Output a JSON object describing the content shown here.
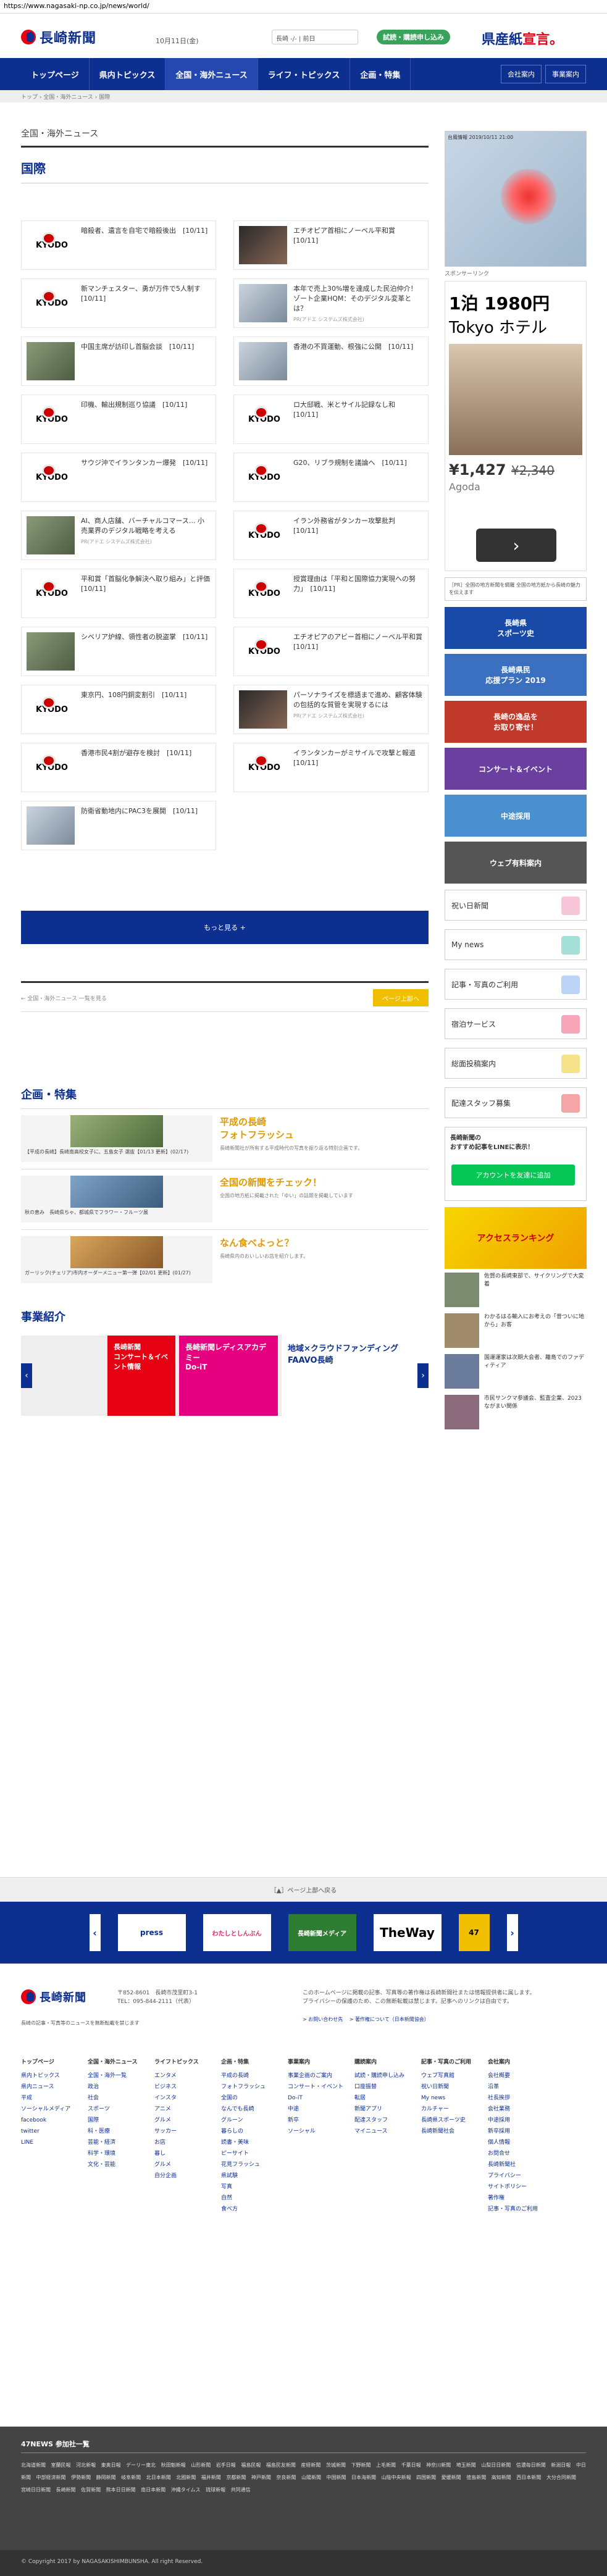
{
  "browser": {
    "url": "https://www.nagasaki-np.co.jp/news/world/"
  },
  "header": {
    "logo": "長崎新聞",
    "date": "10月11日(金)",
    "weather": "長崎  -/-  |  前日",
    "trial": "試読・購読申し込み",
    "slogan_a": "県産紙",
    "slogan_b": "宣言。"
  },
  "nav": {
    "items": [
      "トップページ",
      "県内トピックス",
      "全国・海外ニュース",
      "ライフ・トピックス",
      "企画・特集"
    ],
    "company": "会社案内",
    "business": "事業案内"
  },
  "breadcrumb": "トップ › 全国・海外ニュース › 国際",
  "section": {
    "title": "全国・海外ニュース",
    "subtitle": "国際"
  },
  "articles": [
    {
      "text": "暗殺者、遺言を自宅で暗殺後出　[10/11]",
      "img": "kyodo"
    },
    {
      "text": "エチオピア首相にノーベル平和賞　[10/11]",
      "img": "photo3"
    },
    {
      "text": "新マンチェスター、勇が万件で5人制す　[10/11]",
      "img": "kyodo"
    },
    {
      "text": "本年で売上30%増を達成した民泊仲介！ゾート企業HQM：そのデジタル変革とは？",
      "img": "photo2",
      "pr": "PR(アドエ システムズ株式会社)"
    },
    {
      "text": "中国主席が訪印し首脳会談　[10/11]",
      "img": "photo"
    },
    {
      "text": "香港の不買運動、根強に公開　[10/11]",
      "img": "photo2"
    },
    {
      "text": "印機、輸出規制巡り協議　[10/11]",
      "img": "kyodo"
    },
    {
      "text": "ロ大邸戦、米とサイル記録なし和　[10/11]",
      "img": "kyodo"
    },
    {
      "text": "サウジ沖でイランタンカー爆発　[10/11]",
      "img": "kyodo"
    },
    {
      "text": "G20、リブラ規制を議論へ　[10/11]",
      "img": "kyodo"
    },
    {
      "text": "AI、商人店舗、バーチャルコマース... 小売業界のデジタル戦略を考える",
      "img": "photo",
      "pr": "PR(アドエ システムズ株式会社)"
    },
    {
      "text": "イラン外務省がタンカー攻撃批判　[10/11]",
      "img": "kyodo"
    },
    {
      "text": "平和賞「首脳化争解決へ取り組み」と評価　[10/11]",
      "img": "kyodo"
    },
    {
      "text": "授賞理由は「平和と国際協力実現への努力」　[10/11]",
      "img": "kyodo"
    },
    {
      "text": "シベリア炉線、領性者の脱盗掌　[10/11]",
      "img": "photo"
    },
    {
      "text": "エチオピアのアビー首相にノーベル平和賞　[10/11]",
      "img": "kyodo"
    },
    {
      "text": "東京円、108円銅変割引　[10/11]",
      "img": "kyodo"
    },
    {
      "text": "パーソナライズを標語まで進め、顧客体験の包括的な質管を実現するには",
      "img": "photo3",
      "pr": "PR(アドエ システムズ株式会社)"
    },
    {
      "text": "香港市民4割が避存を検討　[10/11]",
      "img": "kyodo"
    },
    {
      "text": "イランタンカーがミサイルで攻撃と報道　[10/11]",
      "img": "kyodo"
    },
    {
      "text": "防衛省動地内にPAC3を展開　[10/11]",
      "img": "photo2"
    }
  ],
  "more_label": "もっと見る +",
  "pager": {
    "prev": "← 全国・海外ニュース 一覧を見る",
    "next": "ページ上部へ"
  },
  "kikaku": {
    "title": "企画・特集",
    "items": [
      {
        "caption": "【平成の長崎】長崎南高校女子に、五島女子 選抜【01/13 更新】(02/17)",
        "head": "平成の長崎\nフォトフラッシュ",
        "desc": "長崎新聞社が所有する平成時代の写真を振り返る特別企画です。"
      },
      {
        "caption": "秋の恵み　長崎県ちゃ、都城県でフラワー・フルーツ展",
        "head": "全国の新聞をチェック！",
        "desc": "全国の地方紙に掲載された「ゆい」の話題を掲載しています"
      },
      {
        "caption": "ガーリック(チェリア)市内オーダーメニュー第一弾【02/01 更新】(01/27)",
        "head": "なん食べよっと？",
        "desc": "長崎県内のおいしいお店を紹介します。"
      }
    ]
  },
  "jigyo": {
    "title": "事業紹介",
    "banners": [
      "長崎新聞\nコンサート＆イベント情報",
      "長崎新聞レディスアカデミー\nDo-iT",
      "地域×クラウドファンディング\nFAAVO長崎"
    ]
  },
  "sidebar": {
    "typhoon_label": "台風情報  2019/10/11 21:00",
    "sponsor": "スポンサーリンク",
    "ad_h1": "1泊 1980円",
    "ad_h2": "Tokyo ホテル",
    "ad_price": "¥1,427",
    "ad_old": "¥2,340",
    "ad_src": "Agoda",
    "notice": "［PR］全国の地方新聞を網羅 全国の地方紙から長崎の魅力を伝えます",
    "banners": [
      "長崎県\nスポーツ史",
      "長崎県民\n応援プラン 2019",
      "長崎の逸品を\nお取り寄せ！",
      "コンサート＆イベント",
      "中途採用",
      "ウェブ有料案内"
    ],
    "services": [
      "祝い日新聞",
      "My news",
      "記事・写真のご利用",
      "宿泊サービス",
      "総面投稿案内",
      "配達スタッフ募集"
    ],
    "line_title": "長崎新聞の\nおすすめ記事をLINEに表示！",
    "line_btn": "アカウントを友達に追加",
    "rank_label": "アクセスランキング",
    "rank_items": [
      "佐賀の長崎東部で、サイクリングで大変着",
      "わかるはる輸入にお考えの「昔ついに地から」お客",
      "国運運家は次期大会者、離島でのファディティア",
      "市民サンクマ参議会、監査企業、2023 ながまい関係"
    ]
  },
  "bottom_bar": "［▲］ページ上部へ戻る",
  "partners": [
    "press",
    "わたしとしんぶん",
    "長崎新聞メディア",
    "TheWay",
    "47"
  ],
  "footer": {
    "logo": "長崎新聞",
    "address": "〒852-8601　長崎市茂里町3-1\nTEL：095-844-2111（代表）",
    "note": "長崎の記事・写真等のニュースを無断転載を禁じます",
    "right_text": "このホームページに掲載の記事、写真等の著作権は長崎新聞社または情報提供者に属します。\nプライバシーの保護のため、この無断転載は禁じます。記事へのリンクは自由です。",
    "links": "> お問い合わせ先　 > 著作権について（日本新聞協会）",
    "cols": [
      {
        "h": "トップページ",
        "items": [
          "県内トピックス",
          "県内ニュース",
          "平成",
          "ソーシャルメディア",
          "facebook",
          "twitter",
          "LINE"
        ]
      },
      {
        "h": "全国・海外ニュース",
        "items": [
          "全国・海外一覧",
          "政治",
          "社会",
          "スポーツ",
          "国際",
          "科・医療",
          "芸能・経済",
          "科学・環境",
          "文化・芸能"
        ]
      },
      {
        "h": "ライフトピックス",
        "items": [
          "エンタメ",
          "ビジネス",
          "インスタ",
          "アニメ",
          "グルメ",
          "サッカー",
          "お店",
          "暮し",
          "グルメ",
          "自分企画"
        ]
      },
      {
        "h": "企画・特集",
        "items": [
          "平成の長崎",
          "フォトフラッシュ",
          "全国の",
          "なんでも長崎",
          "グルーン",
          "暮らしの",
          "読書・美味",
          "ピーサイト",
          "花見フラッシュ",
          "県試験",
          "写真",
          "自然",
          "食べ方"
        ]
      },
      {
        "h": "事業案内",
        "items": [
          "事業企画のご案内",
          "コンサート・イベント",
          "Do-iT",
          "中途",
          "新卒",
          "ソーシャル"
        ]
      },
      {
        "h": "購読案内",
        "items": [
          "試読・購読申し込み",
          "口座振替",
          "転居",
          "新聞アプリ",
          "配達スタッフ",
          "マイニュース"
        ]
      },
      {
        "h": "記事・写真のご利用",
        "items": [
          "ウェブ写真館",
          "祝い日新聞",
          "My news",
          "カルチャー",
          "長崎県スポーツ史",
          "長崎新聞社会"
        ]
      },
      {
        "h": "会社案内",
        "items": [
          "会社概要",
          "沿革",
          "社長挨拶",
          "会社業務",
          "中途採用",
          "新卒採用",
          "個人情報",
          "お問合せ",
          "長崎新聞社",
          "プライバシー",
          "サイトポリシー",
          "著作権",
          "記事・写真のご利用"
        ]
      }
    ]
  },
  "n47": {
    "title": "47NEWS 参加社一覧",
    "links": "北海道新聞 室蘭民報 河北新報 東奥日報 デーリー東北 秋田魁新報 山形新聞 岩手日報 福島民報 福島民友新聞 産経新聞 茨城新聞 下野新聞 上毛新聞 千葉日報 神奈川新聞 埼玉新聞 山梨日日新聞 信濃毎日新聞 新潟日報 中日新聞 中部経済新聞 伊勢新聞 静岡新聞 岐阜新聞 北日本新聞 北國新聞 福井新聞 京都新聞 神戸新聞 奈良新聞 山陽新聞 中国新聞 日本海新聞 山陰中央新報 四国新聞 愛媛新聞 徳島新聞 高知新聞 西日本新聞 大分合同新聞 宮崎日日新聞 長崎新聞 佐賀新聞 熊本日日新聞 南日本新聞 沖縄タイムス 琉球新報 共同通信"
  },
  "copyright": "© Copyright 2017 by NAGASAKISHIMBUNSHA. All right Reserved."
}
